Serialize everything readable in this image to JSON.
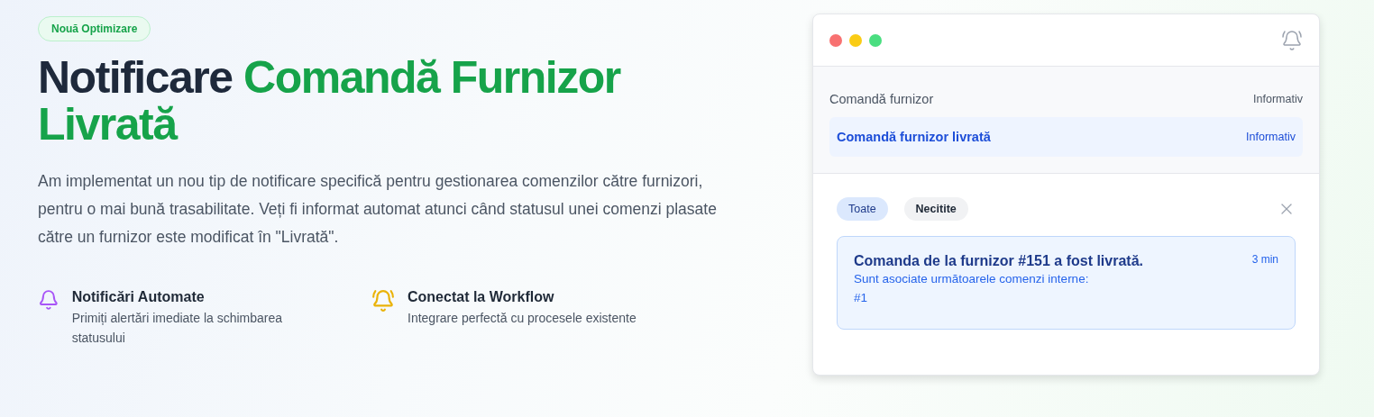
{
  "badge": "Nouă Optimizare",
  "title": {
    "lead": "Notificare",
    "highlight": "Comandă Furnizor Livrată"
  },
  "description": "Am implementat un nou tip de notificare specifică pentru gestionarea comenzilor către furnizori, pentru o mai bună trasabilitate. Veți fi informat automat atunci când statusul unei comenzi plasate către un furnizor este modificat în \"Livrată\".",
  "features": [
    {
      "kind": "bell",
      "title": "Notificări Automate",
      "text": "Primiți alertări imediate la schimbarea statusului"
    },
    {
      "kind": "ringing",
      "title": "Conectat la Workflow",
      "text": "Integrare perfectă cu procesele existente"
    }
  ],
  "preview": {
    "notification_types": [
      {
        "label": "Comandă furnizor",
        "level": "Informativ",
        "selected": false
      },
      {
        "label": "Comandă furnizor livrată",
        "level": "Informativ",
        "selected": true
      }
    ],
    "filters": [
      {
        "label": "Toate",
        "selected": true
      },
      {
        "label": "Necitite",
        "selected": false
      }
    ],
    "notifications": [
      {
        "title": "Comanda de la furnizor #151 a fost livrată.",
        "time": "3 min",
        "body": "Sunt asociate următoarele comenzi interne:",
        "ref": "#1"
      }
    ]
  }
}
